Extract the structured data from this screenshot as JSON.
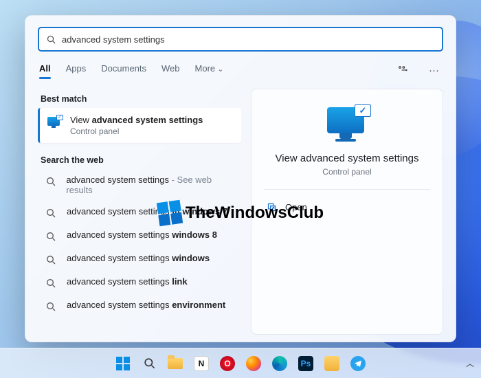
{
  "search": {
    "query": "advanced system settings"
  },
  "tabs": {
    "all": "All",
    "apps": "Apps",
    "documents": "Documents",
    "web": "Web",
    "more": "More"
  },
  "sections": {
    "best_match": "Best match",
    "search_web": "Search the web"
  },
  "best_match": {
    "prefix": "View ",
    "bold": "advanced system settings",
    "subtitle": "Control panel"
  },
  "web_results": [
    {
      "plain": "advanced system settings",
      "bold": "",
      "hint": " - See web results"
    },
    {
      "plain": "advanced system settings ",
      "bold": "in windows 7",
      "hint": ""
    },
    {
      "plain": "advanced system settings ",
      "bold": "windows 8",
      "hint": ""
    },
    {
      "plain": "advanced system settings ",
      "bold": "windows",
      "hint": ""
    },
    {
      "plain": "advanced system settings ",
      "bold": "link",
      "hint": ""
    },
    {
      "plain": "advanced system settings ",
      "bold": "environment",
      "hint": ""
    }
  ],
  "preview": {
    "title": "View advanced system settings",
    "subtitle": "Control panel",
    "open": "Open"
  },
  "watermark": "TheWindowsClub",
  "taskbar": {
    "notion": "N",
    "opera": "O",
    "ps": "Ps"
  }
}
